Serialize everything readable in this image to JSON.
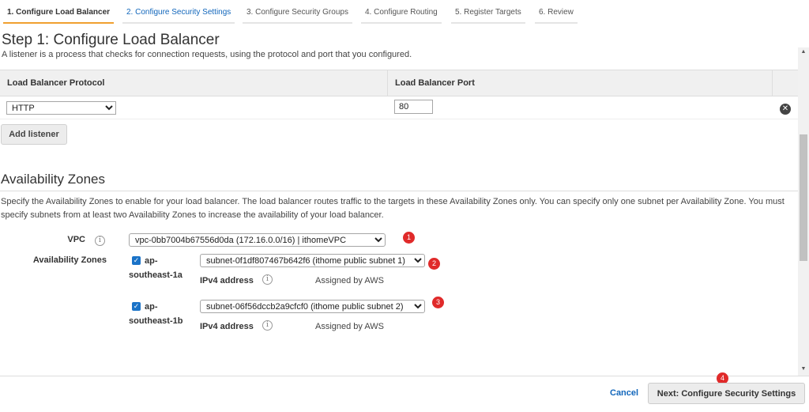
{
  "wizard": {
    "tabs": [
      {
        "label": "1. Configure Load Balancer"
      },
      {
        "label": "2. Configure Security Settings"
      },
      {
        "label": "3. Configure Security Groups"
      },
      {
        "label": "4. Configure Routing"
      },
      {
        "label": "5. Register Targets"
      },
      {
        "label": "6. Review"
      }
    ],
    "active_tab_index": 0
  },
  "step": {
    "title": "Step 1: Configure Load Balancer",
    "description": "A listener is a process that checks for connection requests, using the protocol and port that you configured."
  },
  "listeners": {
    "columns": [
      "Load Balancer Protocol",
      "Load Balancer Port"
    ],
    "rows": [
      {
        "protocol": "HTTP",
        "port": "80"
      }
    ],
    "add_label": "Add listener",
    "remove_icon": "close-circle-icon"
  },
  "availability": {
    "title": "Availability Zones",
    "description": "Specify the Availability Zones to enable for your load balancer. The load balancer routes traffic to the targets in these Availability Zones only. You can specify only one subnet per Availability Zone. You must specify subnets from at least two Availability Zones to increase the availability of your load balancer.",
    "vpc_label": "VPC",
    "vpc_value": "vpc-0bb7004b67556d0da (172.16.0.0/16) | ithomeVPC",
    "zones_label": "Availability Zones",
    "zones": [
      {
        "name": "ap-southeast-1a",
        "checked": true,
        "subnet": "subnet-0f1df807467b642f6 (ithome public subnet 1)",
        "ipv4_label": "IPv4 address",
        "ipv4_value": "Assigned by AWS"
      },
      {
        "name": "ap-southeast-1b",
        "checked": true,
        "subnet": "subnet-06f56dccb2a9cfcf0 (ithome public subnet 2)",
        "ipv4_label": "IPv4 address",
        "ipv4_value": "Assigned by AWS"
      }
    ]
  },
  "annotations": [
    "1",
    "2",
    "3",
    "4"
  ],
  "annotation_color": "#e02a2a",
  "accent_color": "#f0a030",
  "footer": {
    "cancel_label": "Cancel",
    "next_label": "Next: Configure Security Settings"
  }
}
